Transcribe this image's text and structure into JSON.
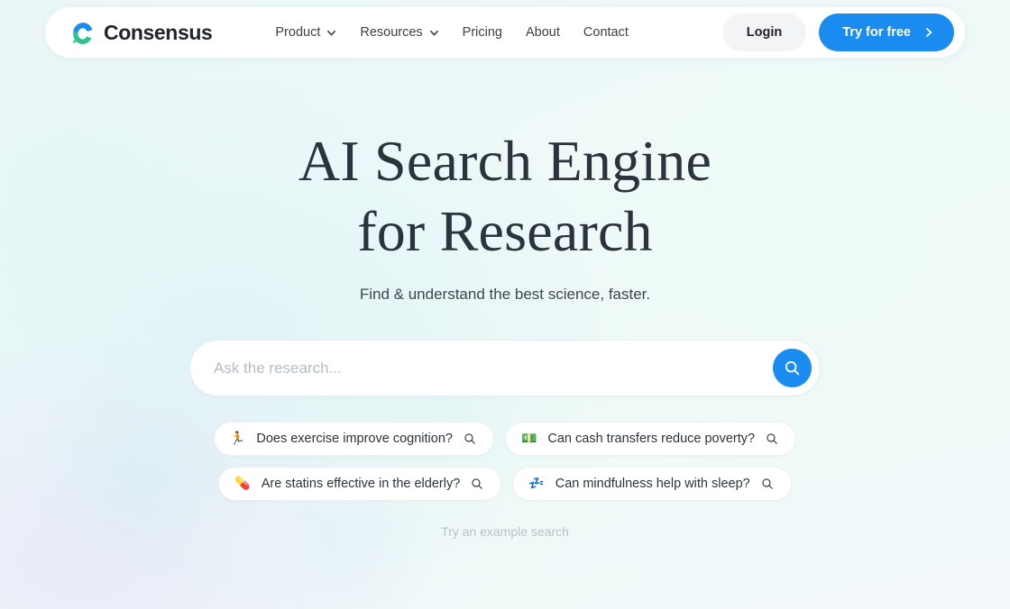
{
  "header": {
    "brand": {
      "name": "Consensus",
      "logo_icon": "consensus-c-logo-icon",
      "logo_colors": {
        "top_arc": "#1a8cf0",
        "body": "#2ec490"
      }
    },
    "nav_items": [
      {
        "label": "Product",
        "has_dropdown": true,
        "icon": "chevron-down-icon"
      },
      {
        "label": "Resources",
        "has_dropdown": true,
        "icon": "chevron-down-icon"
      },
      {
        "label": "Pricing",
        "has_dropdown": false,
        "icon": ""
      },
      {
        "label": "About",
        "has_dropdown": false,
        "icon": ""
      },
      {
        "label": "Contact",
        "has_dropdown": false,
        "icon": ""
      }
    ],
    "login_label": "Login",
    "cta_label": "Try for free",
    "cta_icon": "chevron-right-icon",
    "cta_color": "#1a8cf0"
  },
  "hero": {
    "title_line_1": "AI Search Engine",
    "title_line_2": "for Research",
    "subtitle": "Find & understand the best science, faster.",
    "title_color": "#2b333d"
  },
  "search": {
    "placeholder": "Ask the research...",
    "value": "",
    "submit_icon": "search-icon",
    "submit_color": "#1a8cf0"
  },
  "suggestions": {
    "rows": [
      [
        {
          "emoji": "🏃",
          "emoji_name": "runner-emoji",
          "text": "Does exercise improve cognition?",
          "action_icon": "search-icon"
        },
        {
          "emoji": "💵",
          "emoji_name": "banknote-emoji",
          "text": "Can cash transfers reduce poverty?",
          "action_icon": "search-icon"
        }
      ],
      [
        {
          "emoji": "💊",
          "emoji_name": "pill-emoji",
          "text": "Are statins effective in the elderly?",
          "action_icon": "search-icon"
        },
        {
          "emoji": "💤",
          "emoji_name": "sleep-zzz-emoji",
          "text": "Can mindfulness help with sleep?",
          "action_icon": "search-icon"
        }
      ]
    ],
    "footer_note": "Try an example search"
  }
}
